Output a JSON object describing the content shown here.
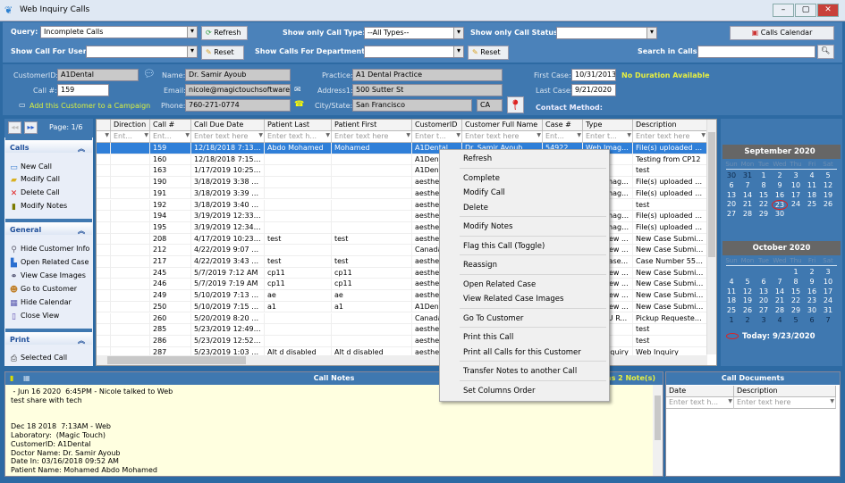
{
  "window": {
    "title": "Web Inquiry Calls"
  },
  "colors": {
    "panel": "#3f78b0",
    "selection": "#2f7fd8",
    "notes_bg": "#ffffe0",
    "highlight_text": "#e8f040"
  },
  "toolbar": {
    "query_label": "Query:",
    "query_value": "Incomplete Calls",
    "refresh": "Refresh",
    "call_type_label": "Show only Call Type:",
    "call_type_value": "--All Types--",
    "status_label": "Show only Call Status:",
    "status_value": "",
    "calendar_btn": "Calls Calendar",
    "user_label": "Show Call For User:",
    "user_value": "",
    "reset": "Reset",
    "dept_label": "Show Calls For Department:",
    "dept_value": "",
    "reset2": "Reset",
    "search_label": "Search in Calls:",
    "search_value": ""
  },
  "customer": {
    "id_label": "CustomerID:",
    "id": "A1Dental",
    "call_label": "Call #:",
    "call": "159",
    "campaign": "Add this Customer to a Campaign",
    "name_label": "Name:",
    "name": "Dr. Samir Ayoub",
    "email_label": "Email:",
    "email": "nicole@magictouchsoftware.co",
    "phone_label": "Phone:",
    "phone": "760-271-0774",
    "practice_label": "Practice:",
    "practice": "A1 Dental Practice",
    "address_label": "Address1:",
    "address": "500 Sutter St",
    "city_label": "City/State:",
    "city": "San Francisco",
    "state": "CA",
    "first_case_label": "First Case:",
    "first_case": "10/31/2013",
    "last_case_label": "Last Case:",
    "last_case": "9/21/2020",
    "duration": "No Duration Available",
    "contact_label": "Contact Method:"
  },
  "sidebar": {
    "page": "Page: 1/6",
    "calls": {
      "title": "Calls",
      "items": [
        "New Call",
        "Modify Call",
        "Delete Call",
        "Modify Notes"
      ]
    },
    "general": {
      "title": "General",
      "items": [
        "Hide Customer Info",
        "Open Related Case",
        "View Case Images",
        "Go to Customer",
        "Hide Calendar",
        "Close View"
      ]
    },
    "print": {
      "title": "Print",
      "items": [
        "Selected Call"
      ]
    }
  },
  "grid": {
    "columns": [
      "Direction",
      "Call #",
      "Call Due Date",
      "Patient Last",
      "Patient First",
      "CustomerID",
      "Customer Full Name",
      "Case #",
      "Type",
      "Description"
    ],
    "filters": [
      "Ent...",
      "Ent...",
      "Enter text here",
      "Enter text h...",
      "Enter text here",
      "Enter t...",
      "Enter text here",
      "Ent...",
      "Enter t...",
      "Enter text here"
    ],
    "rows": [
      [
        "",
        "159",
        "12/18/2018 7:13 ...",
        "Abdo Mohamed",
        "Mohamed",
        "A1Dental",
        "Dr. Samir Ayoub",
        "54922",
        "Web Imag...",
        "File(s) uploaded from"
      ],
      [
        "",
        "160",
        "12/18/2018 7:15 ...",
        "",
        "",
        "A1Dental",
        "",
        "",
        "",
        "Testing from CP12"
      ],
      [
        "",
        "163",
        "1/17/2019 10:25 ...",
        "",
        "",
        "A1Dental",
        "",
        "",
        "",
        "test"
      ],
      [
        "",
        "190",
        "3/18/2019 3:38 PM",
        "",
        "",
        "aesthet",
        "",
        "",
        "Web Imag...",
        "File(s) uploaded from"
      ],
      [
        "",
        "191",
        "3/18/2019 3:39 PM",
        "",
        "",
        "aesthet",
        "",
        "",
        "Web Imag...",
        "File(s) uploaded from"
      ],
      [
        "",
        "192",
        "3/18/2019 3:40 PM",
        "",
        "",
        "aesthet",
        "",
        "",
        "",
        "test"
      ],
      [
        "",
        "194",
        "3/19/2019 12:33 PM",
        "",
        "",
        "aesthet",
        "",
        "",
        "Web Images ...",
        "File(s) uploaded from"
      ],
      [
        "",
        "195",
        "3/19/2019 12:34 PM",
        "",
        "",
        "aesthet",
        "",
        "",
        "Web Images ...",
        "File(s) uploaded from"
      ],
      [
        "",
        "208",
        "4/17/2019 10:23 ...",
        "test",
        "test",
        "aesthet",
        "",
        "",
        "Web New ...",
        "New Case Submitted"
      ],
      [
        "",
        "212",
        "4/22/2019 9:07 AM",
        "",
        "",
        "Canada",
        "",
        "",
        "Web New ...",
        "New Case Submitted"
      ],
      [
        "",
        "217",
        "4/22/2019 3:43 PM",
        "test",
        "test",
        "aesthet",
        "",
        "",
        "Web Case...",
        "Case Number 55563 ("
      ],
      [
        "",
        "245",
        "5/7/2019 7:12 AM",
        "cp11",
        "cp11",
        "aesthet",
        "",
        "",
        "Web New ...",
        "New Case Submitted"
      ],
      [
        "",
        "246",
        "5/7/2019 7:19 AM",
        "cp11",
        "cp11",
        "aesthet",
        "",
        "",
        "Web New ...",
        "New Case Submitted"
      ],
      [
        "",
        "249",
        "5/10/2019 7:13 AM",
        "ae",
        "ae",
        "aesthet",
        "",
        "",
        "Web New ...",
        "New Case Submitted"
      ],
      [
        "",
        "250",
        "5/10/2019 7:15 AM",
        "a1",
        "a1",
        "A1Dental",
        "",
        "",
        "Web New ...",
        "New Case Submitted"
      ],
      [
        "",
        "260",
        "5/20/2019 8:20 AM",
        "",
        "",
        "Canada",
        "",
        "",
        "Web PU R...",
        "Pickup Requested (Ca"
      ],
      [
        "",
        "285",
        "5/23/2019 12:49 PM",
        "",
        "",
        "aesthet",
        "",
        "",
        "",
        "test"
      ],
      [
        "",
        "286",
        "5/23/2019 12:52 PM",
        "",
        "",
        "aesthet",
        "",
        "",
        "",
        "test"
      ],
      [
        "",
        "287",
        "5/23/2019 1:03 PM",
        "Alt d disabled",
        "Alt d disabled",
        "aesthet",
        "",
        "",
        "Web Inquiry",
        "Web Inquiry"
      ]
    ]
  },
  "calendar": {
    "months": [
      {
        "title": "September 2020",
        "lead": [
          30,
          31
        ],
        "days": 30,
        "first_weekday": 2,
        "trail": []
      },
      {
        "title": "October 2020",
        "lead": [],
        "days": 31,
        "first_weekday": 4,
        "trail": [
          1,
          2,
          3,
          4,
          5,
          6,
          7
        ]
      }
    ],
    "weekdays": [
      "Sun",
      "Mon",
      "Tue",
      "Wed",
      "Thu",
      "Fri",
      "Sat"
    ],
    "selected_day": 23,
    "today": "Today: 9/23/2020"
  },
  "notes": {
    "title": "Call Notes",
    "count": "has 2 Note(s)",
    "text": " - Jun 16 2020  6:45PM - Nicole talked to Web\ntest share with tech\n\n\nDec 18 2018  7:13AM - Web\nLaboratory:  (Magic Touch)\nCustomerID: A1Dental\nDoctor Name: Dr. Samir Ayoub\nDate In: 03/16/2018 09:52 AM\nPatient Name: Mohamed Abdo Mohamed"
  },
  "documents": {
    "title": "Call Documents",
    "columns": [
      "Date",
      "Description"
    ],
    "filters": [
      "Enter text h...",
      "Enter text here"
    ]
  },
  "context_menu": {
    "groups": [
      [
        "Refresh"
      ],
      [
        "Complete",
        "Modify Call",
        "Delete"
      ],
      [
        "Modify Notes"
      ],
      [
        "Flag this Call (Toggle)"
      ],
      [
        "Reassign"
      ],
      [
        "Open Related Case",
        "View Related Case Images"
      ],
      [
        "Go To Customer"
      ],
      [
        "Print this Call",
        "Print all Calls for this Customer"
      ],
      [
        "Transfer Notes to another Call"
      ],
      [
        "Set Columns Order"
      ]
    ]
  }
}
